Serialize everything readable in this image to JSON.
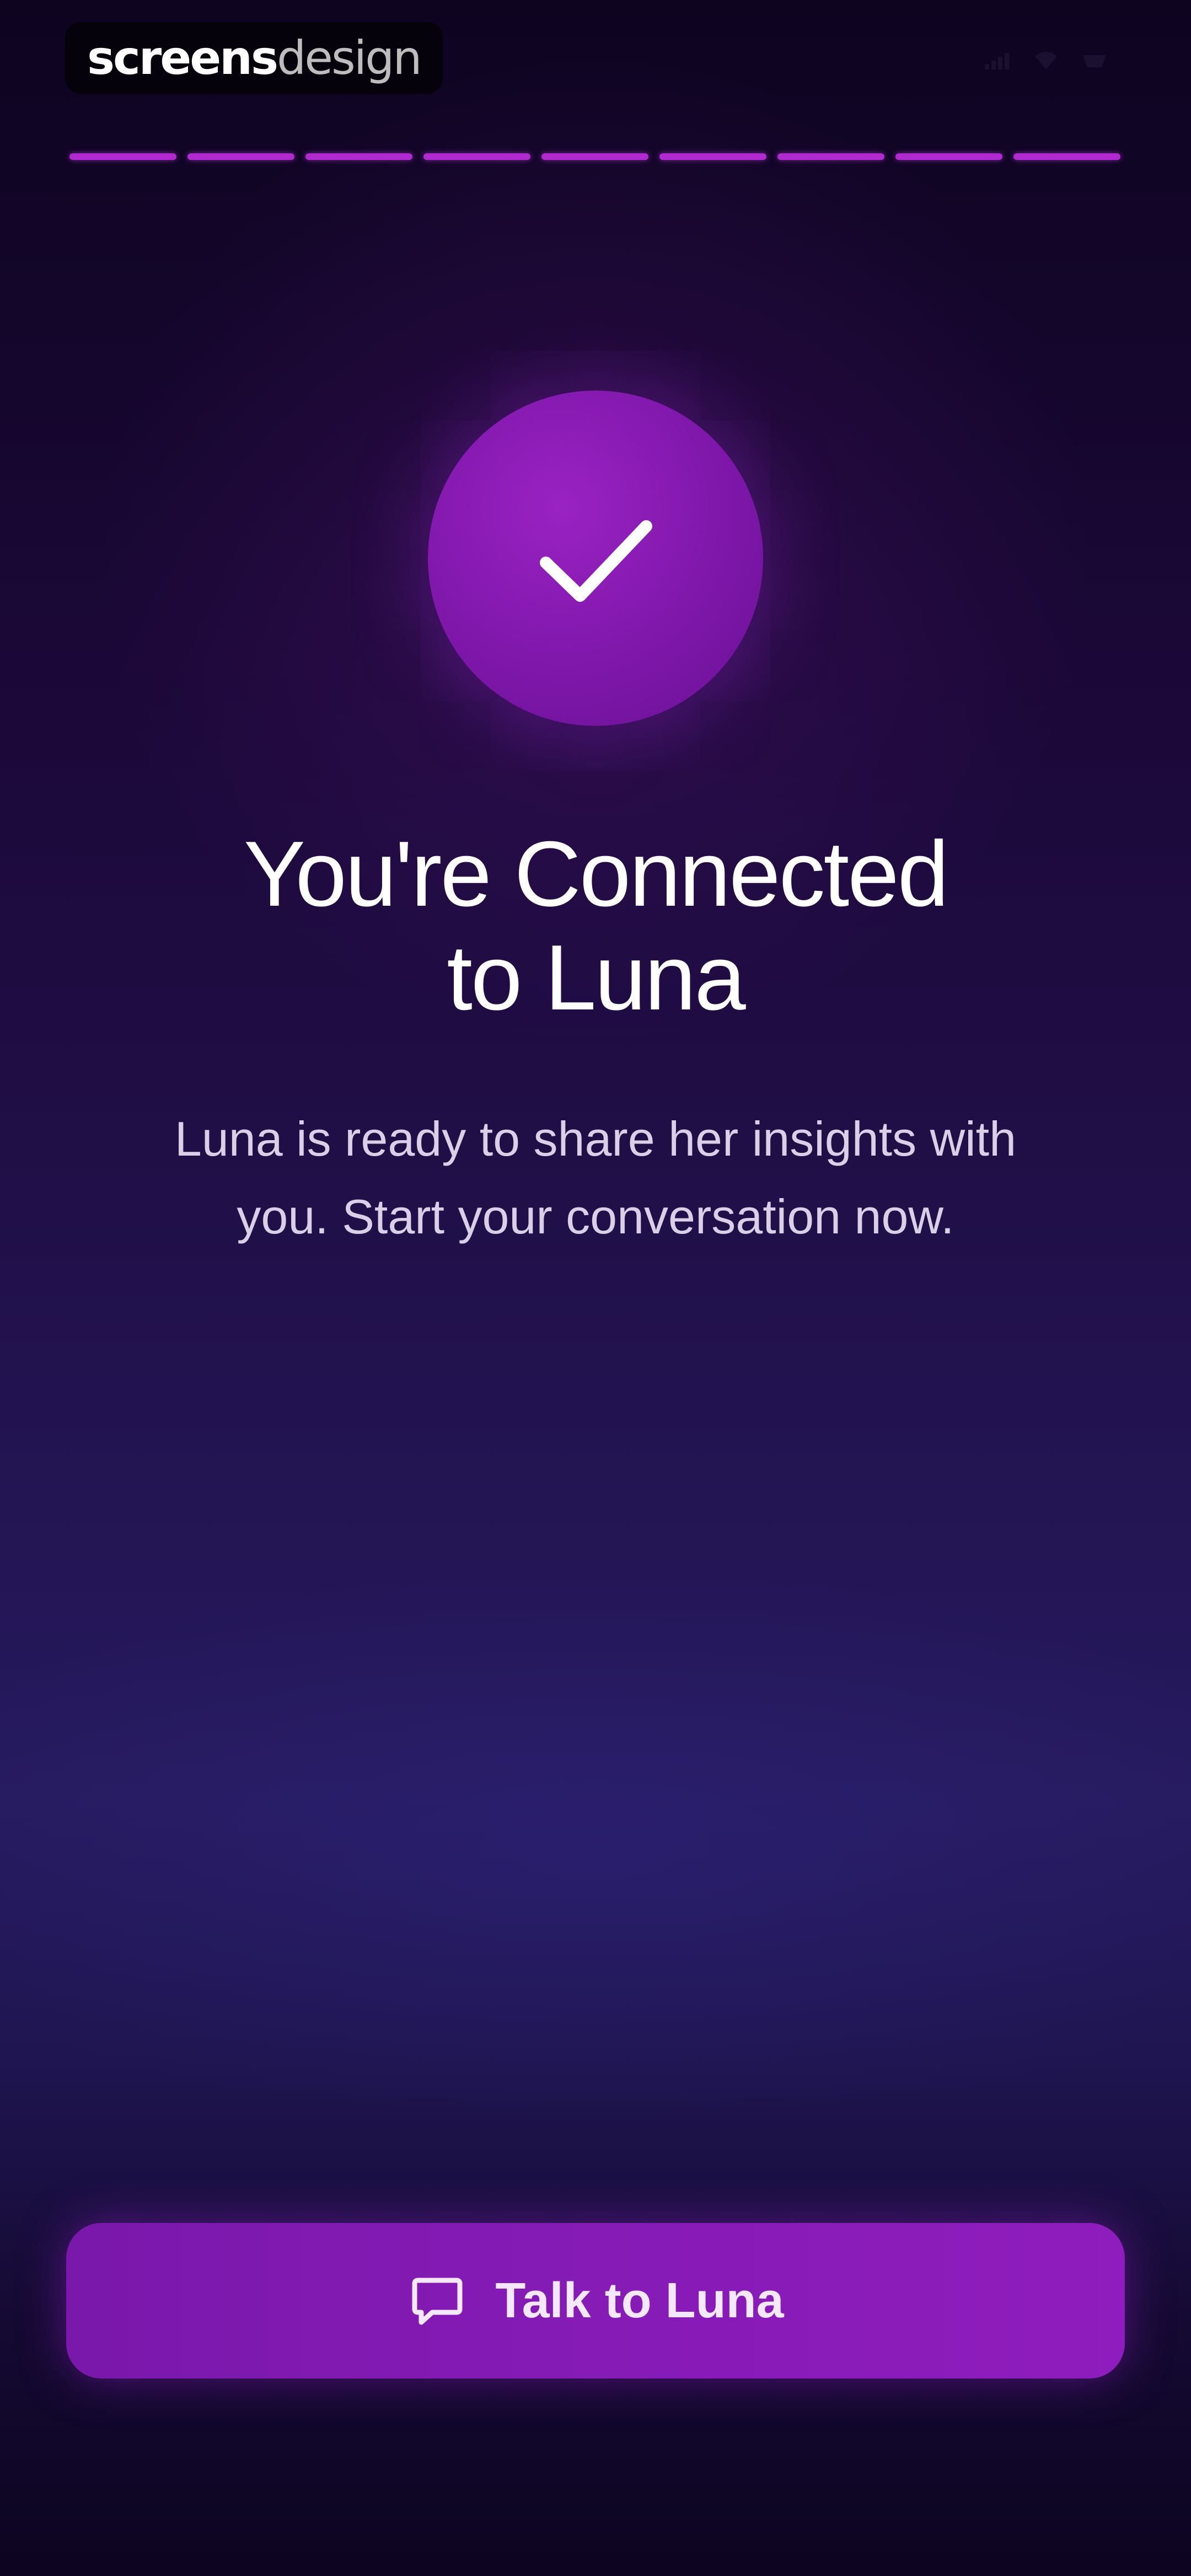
{
  "brand": {
    "strong": "screens",
    "light": "design"
  },
  "status_bar": {
    "icons": [
      "signal-icon",
      "wifi-icon",
      "battery-icon"
    ]
  },
  "progress": {
    "total_steps": 9,
    "completed_steps": 9
  },
  "main": {
    "icon": "checkmark-icon",
    "title_line1": "You're Connected",
    "title_line2": "to Luna",
    "description_line1": "Luna is ready to share her insights with",
    "description_line2": "you. Start your conversation now."
  },
  "cta": {
    "icon": "chat-bubble-icon",
    "label": "Talk to Luna"
  },
  "colors": {
    "accent": "#861bb6",
    "background_top": "#0e0420",
    "background_mid": "#231453"
  }
}
